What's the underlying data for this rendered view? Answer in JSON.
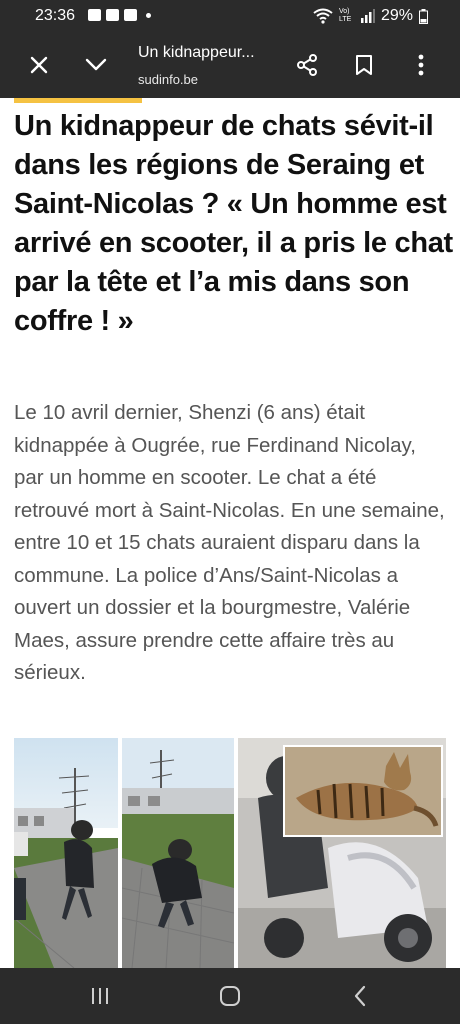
{
  "status_bar": {
    "time": "23:36",
    "network_label": "Vo) LTE",
    "battery": "29%"
  },
  "toolbar": {
    "title": "Un kidnappeur...",
    "domain": "sudinfo.be"
  },
  "article": {
    "headline": "Un kidnappeur de chats sévit-il dans les régions de Seraing et Saint-Nicolas ? « Un homme est arrivé en scooter, il a pris le chat par la tête et l’a mis dans son coffre ! »",
    "lede": "Le 10 avril dernier, Shenzi (6 ans) était kidnappée à Ougrée, rue Ferdinand Nicolay, par un homme en scooter. Le chat a été retrouvé mort à Saint-Nicolas. En une semaine, entre 10 et 15 chats auraient disparu dans la commune. La police d’Ans/Saint-Nicolas a ouvert un dossier et la bourgmestre, Valérie Maes, assure prendre cette affaire très au sérieux."
  },
  "colors": {
    "chrome": "#2b2b2b",
    "accent": "#f5c242",
    "headline": "#111111",
    "lede": "#555555"
  },
  "icons": {
    "close": "close-icon",
    "collapse": "chevron-down-icon",
    "share": "share-icon",
    "bookmark": "bookmark-icon",
    "menu": "more-vert-icon"
  }
}
